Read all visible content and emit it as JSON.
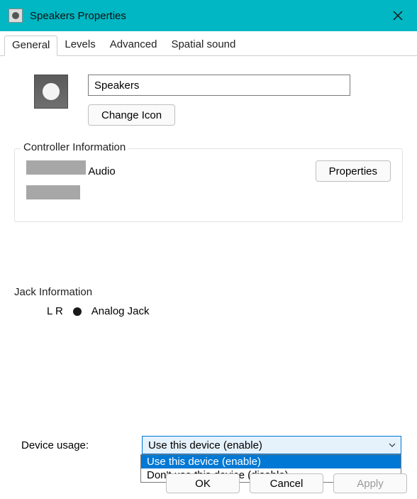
{
  "window": {
    "title": "Speakers Properties"
  },
  "tabs": {
    "t0": "General",
    "t1": "Levels",
    "t2": "Advanced",
    "t3": "Spatial sound",
    "active": 0
  },
  "device": {
    "name_value": "Speakers",
    "change_icon": "Change Icon"
  },
  "controller": {
    "group_label": "Controller Information",
    "line1_suffix": "Audio",
    "properties_btn": "Properties"
  },
  "jack": {
    "group_label": "Jack Information",
    "lr": "L R",
    "name": "Analog Jack"
  },
  "usage": {
    "label": "Device usage:",
    "selected": "Use this device (enable)",
    "opt0": "Use this device (enable)",
    "opt1": "Don't use this device (disable)"
  },
  "footer": {
    "ok": "OK",
    "cancel": "Cancel",
    "apply": "Apply"
  }
}
